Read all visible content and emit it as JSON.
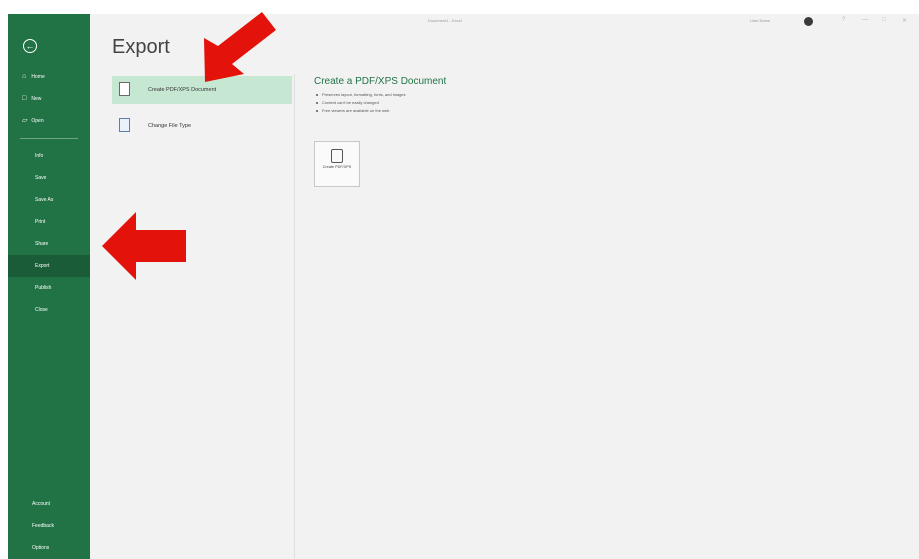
{
  "window": {
    "doc_title": "Document1 - Excel",
    "user_name": "User Name",
    "controls": [
      "?",
      "—",
      "□",
      "✕"
    ]
  },
  "sidebar": {
    "back_icon": "back-arrow-icon",
    "top_items": [
      {
        "label": "Home",
        "icon": "home-icon"
      },
      {
        "label": "New",
        "icon": "new-icon"
      },
      {
        "label": "Open",
        "icon": "folder-icon"
      }
    ],
    "middle_items": [
      {
        "label": "Info"
      },
      {
        "label": "Save"
      },
      {
        "label": "Save As"
      },
      {
        "label": "Print"
      },
      {
        "label": "Share"
      },
      {
        "label": "Export",
        "selected": true
      },
      {
        "label": "Publish"
      },
      {
        "label": "Close"
      }
    ],
    "bottom_items": [
      {
        "label": "Account"
      },
      {
        "label": "Feedback"
      },
      {
        "label": "Options"
      }
    ]
  },
  "main": {
    "title": "Export",
    "options": [
      {
        "label": "Create PDF/XPS Document",
        "icon": "pdf-document-icon",
        "active": true
      },
      {
        "label": "Change File Type",
        "icon": "file-type-icon",
        "active": false
      }
    ],
    "details": {
      "heading": "Create a PDF/XPS Document",
      "bullets": [
        "Preserves layout, formatting, fonts, and images",
        "Content can't be easily changed",
        "Free viewers are available on the web"
      ],
      "button_label": "Create PDF/XPS"
    }
  },
  "colors": {
    "sidebar": "#217346",
    "selected_nav": "#1a5c38",
    "active_option": "#c6e7d2",
    "annotation_arrow": "#e3120b"
  }
}
